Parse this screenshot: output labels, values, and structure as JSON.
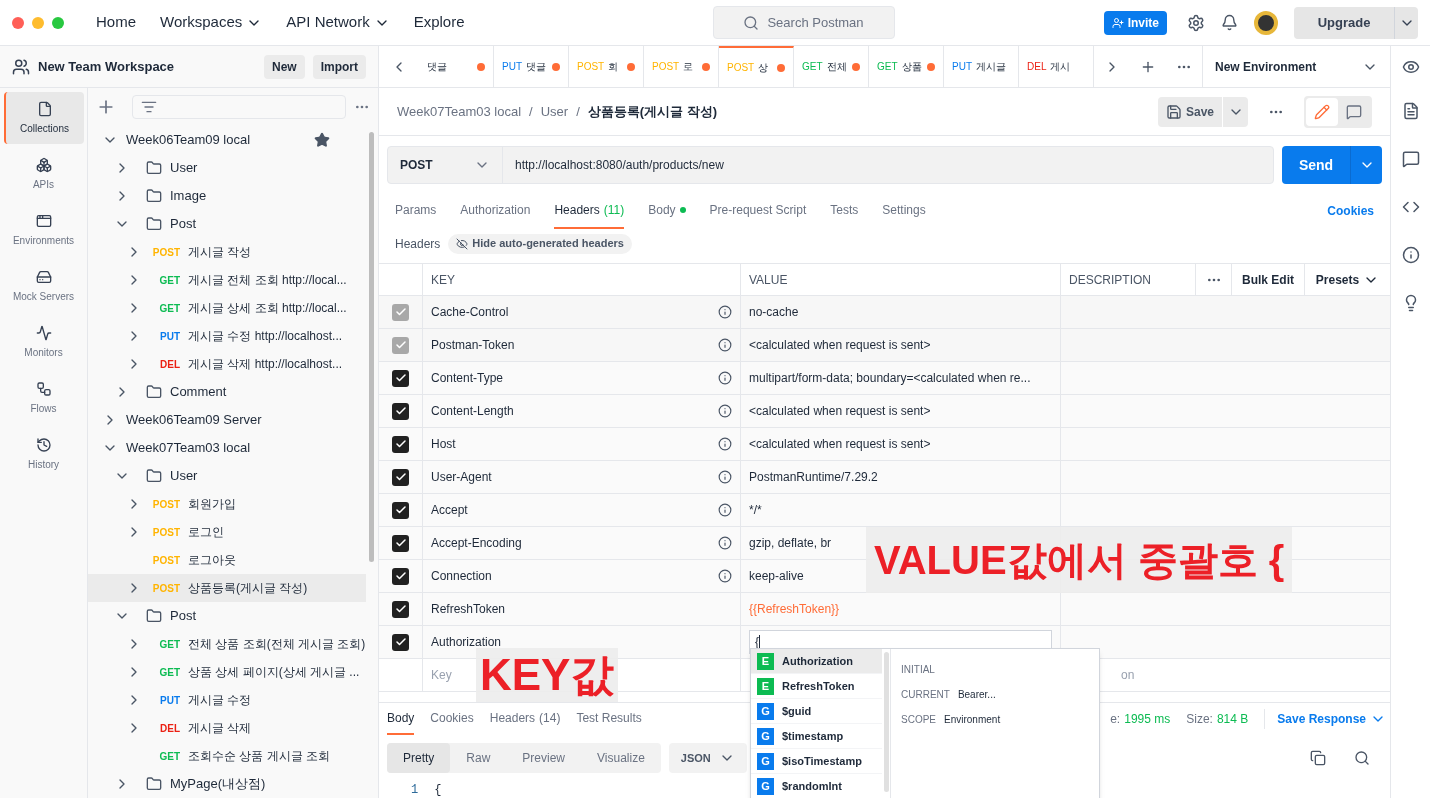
{
  "topbar": {
    "nav": [
      {
        "label": "Home",
        "menu": false
      },
      {
        "label": "Workspaces",
        "menu": true
      },
      {
        "label": "API Network",
        "menu": true
      },
      {
        "label": "Explore",
        "menu": false
      }
    ],
    "search": {
      "placeholder": "Search Postman"
    },
    "invite": "Invite",
    "upgrade": "Upgrade"
  },
  "workspace": {
    "name": "New Team Workspace",
    "buttons": [
      "New",
      "Import"
    ]
  },
  "sidebar_nav": [
    {
      "label": "Collections",
      "selected": true
    },
    {
      "label": "APIs",
      "selected": false
    },
    {
      "label": "Environments",
      "selected": false
    },
    {
      "label": "Mock Servers",
      "selected": false
    },
    {
      "label": "Monitors",
      "selected": false
    },
    {
      "label": "Flows",
      "selected": false
    },
    {
      "label": "History",
      "selected": false
    }
  ],
  "tree": [
    {
      "kind": "collection",
      "label": "Week06Team09 local",
      "expanded": true,
      "starred": true,
      "children": [
        {
          "kind": "folder",
          "label": "User",
          "expanded": false
        },
        {
          "kind": "folder",
          "label": "Image",
          "expanded": false
        },
        {
          "kind": "folder",
          "label": "Post",
          "expanded": true,
          "children": [
            {
              "kind": "request",
              "method": "POST",
              "color": "#ffb400",
              "label": "게시글 작성",
              "expanded": false,
              "selected": false
            },
            {
              "kind": "request",
              "method": "GET",
              "color": "#0cbb52",
              "label": "게시글 전체 조회 http://local...",
              "expanded": false,
              "selected": false
            },
            {
              "kind": "request",
              "method": "GET",
              "color": "#0cbb52",
              "label": "게시글 상세 조회 http://local...",
              "expanded": false,
              "selected": false
            },
            {
              "kind": "request",
              "method": "PUT",
              "color": "#097bed",
              "label": "게시글 수정 http://localhost...",
              "expanded": false,
              "selected": false
            },
            {
              "kind": "request",
              "method": "DEL",
              "color": "#eb2013",
              "label": "게시글 삭제 http://localhost...",
              "expanded": false,
              "selected": false
            }
          ]
        },
        {
          "kind": "folder",
          "label": "Comment",
          "expanded": false
        }
      ]
    },
    {
      "kind": "collection",
      "label": "Week06Team09 Server",
      "expanded": false,
      "starred": false
    },
    {
      "kind": "collection",
      "label": "Week07Team03 local",
      "expanded": true,
      "starred": false,
      "children": [
        {
          "kind": "folder",
          "label": "User",
          "expanded": true,
          "children": [
            {
              "kind": "request",
              "method": "POST",
              "color": "#ffb400",
              "label": "회원가입",
              "expanded": false,
              "selected": false
            },
            {
              "kind": "request",
              "method": "POST",
              "color": "#ffb400",
              "label": "로그인",
              "expanded": false,
              "selected": false
            },
            {
              "kind": "request",
              "method": "POST",
              "color": "#ffb400",
              "label": "로그아웃",
              "selected": false
            },
            {
              "kind": "request",
              "method": "POST",
              "color": "#ffb400",
              "label": "상품등록(게시글 작성)",
              "expanded": false,
              "selected": true
            }
          ]
        },
        {
          "kind": "folder",
          "label": "Post",
          "expanded": true,
          "children": [
            {
              "kind": "request",
              "method": "GET",
              "color": "#0cbb52",
              "label": "전체 상품 조회(전체 게시글 조회)",
              "expanded": false,
              "selected": false
            },
            {
              "kind": "request",
              "method": "GET",
              "color": "#0cbb52",
              "label": "상품 상세 페이지(상세 게시글 ...",
              "expanded": false,
              "selected": false
            },
            {
              "kind": "request",
              "method": "PUT",
              "color": "#097bed",
              "label": "게시글 수정",
              "expanded": false,
              "selected": false
            },
            {
              "kind": "request",
              "method": "DEL",
              "color": "#eb2013",
              "label": "게시글 삭제",
              "expanded": false,
              "selected": false
            },
            {
              "kind": "request",
              "method": "GET",
              "color": "#0cbb52",
              "label": "조회수순 상품 게시글 조회",
              "selected": false
            }
          ]
        },
        {
          "kind": "folder",
          "label": "MyPage(내상점)",
          "expanded": false
        }
      ]
    }
  ],
  "tabs": [
    {
      "label": "댓글",
      "unsaved": true,
      "selected": false
    },
    {
      "method": "PUT",
      "color": "#097bed",
      "label": "댓글",
      "unsaved": true,
      "selected": false
    },
    {
      "method": "POST",
      "color": "#ffb400",
      "label": "회",
      "unsaved": true,
      "selected": false
    },
    {
      "method": "POST",
      "color": "#ffb400",
      "label": "로",
      "unsaved": true,
      "selected": false
    },
    {
      "method": "POST",
      "color": "#ffb400",
      "label": "상",
      "unsaved": true,
      "selected": true
    },
    {
      "method": "GET",
      "color": "#0cbb52",
      "label": "전체",
      "unsaved": true,
      "selected": false
    },
    {
      "method": "GET",
      "color": "#0cbb52",
      "label": "상품",
      "unsaved": true,
      "selected": false
    },
    {
      "method": "PUT",
      "color": "#097bed",
      "label": "게시글",
      "unsaved": false,
      "selected": false
    },
    {
      "method": "DEL",
      "color": "#eb2013",
      "label": "게시",
      "unsaved": false,
      "selected": false
    }
  ],
  "environment": "New Environment",
  "breadcrumb": {
    "separator": "/",
    "items": [
      "Week07Team03 local",
      "User",
      "상품등록(게시글 작성)"
    ]
  },
  "save": "Save",
  "request": {
    "method": "POST",
    "url": "http://localhost:8080/auth/products/new",
    "send": "Send"
  },
  "request_tabs": [
    {
      "label": "Params",
      "selected": false
    },
    {
      "label": "Authorization",
      "selected": false
    },
    {
      "label": "Headers",
      "count": "(11)",
      "selected": true
    },
    {
      "label": "Body",
      "dot": true,
      "selected": false
    },
    {
      "label": "Pre-request Script",
      "selected": false
    },
    {
      "label": "Tests",
      "selected": false
    },
    {
      "label": "Settings",
      "selected": false
    }
  ],
  "cookies": "Cookies",
  "headers_bar": {
    "label": "Headers",
    "toggle": "Hide auto-generated headers"
  },
  "table": {
    "columns": [
      "KEY",
      "VALUE",
      "DESCRIPTION"
    ],
    "bulk_edit": "Bulk Edit",
    "presets": "Presets",
    "rows": [
      {
        "checked": true,
        "disabled": true,
        "key": "Cache-Control",
        "info": true,
        "value": "no-cache",
        "kind": "text"
      },
      {
        "checked": true,
        "disabled": true,
        "key": "Postman-Token",
        "info": true,
        "value": "<calculated when request is sent>",
        "kind": "text"
      },
      {
        "checked": true,
        "disabled": false,
        "key": "Content-Type",
        "info": true,
        "value": "multipart/form-data; boundary=<calculated when re...",
        "kind": "text"
      },
      {
        "checked": true,
        "disabled": false,
        "key": "Content-Length",
        "info": true,
        "value": "<calculated when request is sent>",
        "kind": "text"
      },
      {
        "checked": true,
        "disabled": false,
        "key": "Host",
        "info": true,
        "value": "<calculated when request is sent>",
        "kind": "text"
      },
      {
        "checked": true,
        "disabled": false,
        "key": "User-Agent",
        "info": true,
        "value": "PostmanRuntime/7.29.2",
        "kind": "text"
      },
      {
        "checked": true,
        "disabled": false,
        "key": "Accept",
        "info": true,
        "value": "*/*",
        "kind": "text"
      },
      {
        "checked": true,
        "disabled": false,
        "key": "Accept-Encoding",
        "info": true,
        "value": "gzip, deflate, br",
        "kind": "text"
      },
      {
        "checked": true,
        "disabled": false,
        "key": "Connection",
        "info": true,
        "value": "keep-alive",
        "kind": "text"
      },
      {
        "checked": true,
        "disabled": false,
        "key": "RefreshToken",
        "info": false,
        "value": "{{RefreshToken}}",
        "kind": "variable"
      },
      {
        "checked": true,
        "disabled": false,
        "key": "Authorization",
        "info": false,
        "value": "{",
        "kind": "input"
      }
    ],
    "new_row": {
      "key_placeholder": "Key",
      "description_placeholder": "on"
    }
  },
  "autocomplete": {
    "items": [
      {
        "badge": "E",
        "color": "#0cbb52",
        "label": "Authorization",
        "selected": true
      },
      {
        "badge": "E",
        "color": "#0cbb52",
        "label": "RefreshToken",
        "selected": false
      },
      {
        "badge": "G",
        "color": "#097bed",
        "label": "$guid",
        "selected": false
      },
      {
        "badge": "G",
        "color": "#097bed",
        "label": "$timestamp",
        "selected": false
      },
      {
        "badge": "G",
        "color": "#097bed",
        "label": "$isoTimestamp",
        "selected": false
      },
      {
        "badge": "G",
        "color": "#097bed",
        "label": "$randomInt",
        "selected": false
      }
    ],
    "details": [
      {
        "label": "INITIAL"
      },
      {
        "label": "CURRENT",
        "value": "Bearer..."
      },
      {
        "label": "SCOPE",
        "value": "Environment"
      }
    ]
  },
  "response": {
    "tabs": [
      {
        "label": "Body",
        "selected": true
      },
      {
        "label": "Cookies",
        "selected": false
      },
      {
        "label": "Headers",
        "count": "(14)",
        "selected": false
      },
      {
        "label": "Test Results",
        "selected": false
      }
    ],
    "time_tail": "e:",
    "time": "1995 ms",
    "size_label": "Size:",
    "size": "814 B",
    "save": "Save Response",
    "views": [
      {
        "label": "Pretty",
        "selected": true
      },
      {
        "label": "Raw",
        "selected": false
      },
      {
        "label": "Preview",
        "selected": false
      },
      {
        "label": "Visualize",
        "selected": false
      }
    ],
    "format": "JSON",
    "lines": [
      {
        "number": "1",
        "text": "{"
      }
    ]
  },
  "annotations": [
    {
      "text": "VALUE값에서 중괄호 {"
    },
    {
      "text": "KEY값"
    }
  ]
}
